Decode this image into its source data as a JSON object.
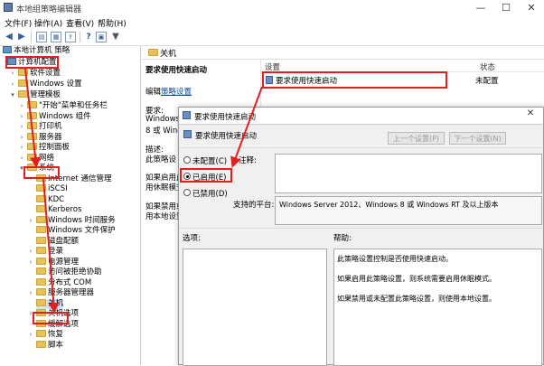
{
  "window": {
    "title": "本地组策略编辑器",
    "min": "—",
    "max": "☐",
    "close": "✕"
  },
  "menu": [
    "文件(F)",
    "操作(A)",
    "查看(V)",
    "帮助(H)"
  ],
  "tree": {
    "root": "本地计算机 策略",
    "computer_config": "计算机配置",
    "software_settings": "软件设置",
    "windows_settings": "Windows 设置",
    "admin_templates": "管理模板",
    "items": [
      "\"开始\"菜单和任务栏",
      "Windows 组件",
      "打印机",
      "服务器",
      "控制面板",
      "网络",
      "系统",
      "Internet 通信管理",
      "iSCSI",
      "KDC",
      "Kerberos",
      "Windows 时间服务",
      "Windows 文件保护",
      "磁盘配额",
      "登录",
      "电源管理",
      "访问被拒绝协助",
      "分布式 COM",
      "服务器管理器",
      "关机",
      "关机选项",
      "缓解选项",
      "恢复",
      "脚本"
    ]
  },
  "right": {
    "folder_label": "关机",
    "policy_title": "要求使用快速启动",
    "edit_prefix": "编辑",
    "edit_link": "策略设置",
    "req_label": "要求:",
    "req_line1": "Windows",
    "req_line2": "8 或 Wind",
    "desc_label": "描述:",
    "desc_line1": "此策略设",
    "desc_line2": "如果启用此",
    "desc_line3": "用休眠模式",
    "desc_line4": "如果禁用或",
    "desc_line5": "用本地设置",
    "col_setting": "设置",
    "col_state": "状态",
    "row_name": "要求使用快速启动",
    "row_state": "未配置"
  },
  "dialog": {
    "title": "要求使用快速启动",
    "subtitle": "要求使用快速启动",
    "prev_btn": "上一个设置(P)",
    "next_btn": "下一个设置(N)",
    "radio_notconfigured": "未配置(C)",
    "radio_enabled": "已启用(E)",
    "radio_disabled": "已禁用(D)",
    "comment_label": "注释:",
    "supported_label": "支持的平台:",
    "supported_value": "Windows Server 2012、Windows 8 或 Windows RT 及以上版本",
    "options_label": "选项:",
    "help_label": "帮助:",
    "help_p1": "此策略设置控制是否使用快速启动。",
    "help_p2": "如果启用此策略设置，则系统需要启用休眠模式。",
    "help_p3": "如果禁用或未配置此策略设置，则使用本地设置。"
  },
  "colors": {
    "highlight": "#e02020",
    "selection": "#cce8ff",
    "folder": "#e6c25a",
    "link": "#0645ad"
  }
}
